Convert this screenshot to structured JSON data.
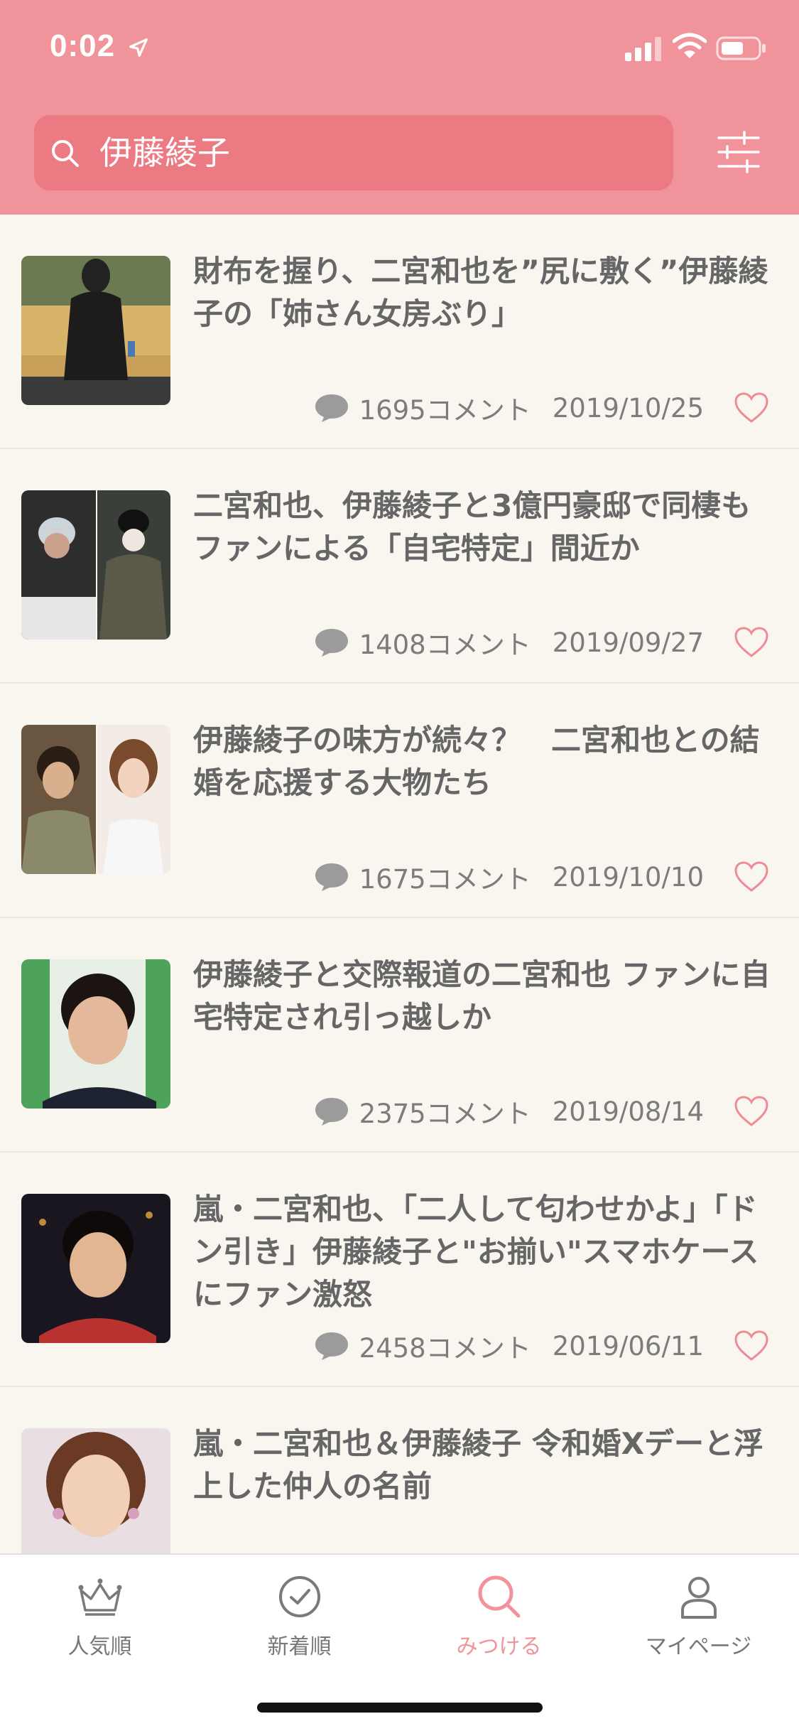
{
  "status_bar": {
    "time": "0:02"
  },
  "search": {
    "query": "伊藤綾子"
  },
  "articles": [
    {
      "title": "財布を握り、二宮和也を”尻に敷く”伊藤綾子の「姉さん女房ぶり」",
      "comments": "1695コメント",
      "date": "2019/10/25",
      "thumb": "person-in-black-coat-photo"
    },
    {
      "title": "二宮和也、伊藤綾子と3億円豪邸で同棲もファンによる「自宅特定」間近か",
      "comments": "1408コメント",
      "date": "2019/09/27",
      "thumb": "two-paparazzi-photos"
    },
    {
      "title": "伊藤綾子の味方が続々？　二宮和也との結婚を応援する大物たち",
      "comments": "1675コメント",
      "date": "2019/10/10",
      "thumb": "two-portrait-photos"
    },
    {
      "title": "伊藤綾子と交際報道の二宮和也 ファンに自宅特定され引っ越しか",
      "comments": "2375コメント",
      "date": "2019/08/14",
      "thumb": "smiling-man-photo"
    },
    {
      "title": "嵐・二宮和也、「二人して匂わせかよ」「ドン引き」伊藤綾子と\"お揃い\"スマホケースにファン激怒",
      "comments": "2458コメント",
      "date": "2019/06/11",
      "thumb": "man-at-event-photo"
    },
    {
      "title": "嵐・二宮和也＆伊藤綾子 令和婚Xデーと浮上した仲人の名前",
      "comments": "",
      "date": "",
      "thumb": "woman-portrait-photo"
    }
  ],
  "tabs": [
    {
      "label": "人気順",
      "icon": "crown-icon"
    },
    {
      "label": "新着順",
      "icon": "clock-check-icon"
    },
    {
      "label": "みつける",
      "icon": "search-icon"
    },
    {
      "label": "マイページ",
      "icon": "person-icon"
    }
  ],
  "colors": {
    "header": "#f0939a",
    "search_field": "#ec7a83",
    "background": "#f9f5ef",
    "accent": "#f0939a",
    "heart": "#ee8c95"
  }
}
